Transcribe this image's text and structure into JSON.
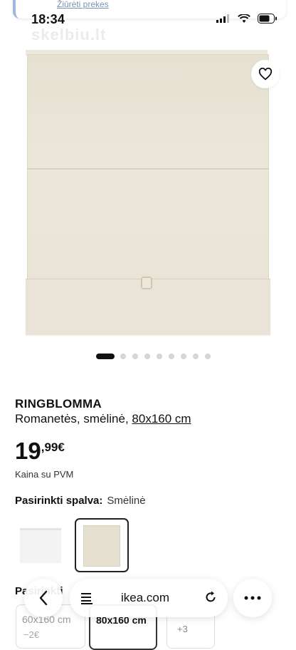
{
  "notification": {
    "link_text": "Žiūrėti prekes"
  },
  "status": {
    "time": "18:34"
  },
  "watermark": "skelbiu.lt",
  "product": {
    "brand": "RINGBLOMMA",
    "subtitle_prefix": "Romanetės, smėlinė, ",
    "size_link": "80x160 cm",
    "price_main": "19",
    "price_cents": ",99€",
    "vat_text": "Kaina su PVM"
  },
  "carousel": {
    "count": 9,
    "active_index": 0
  },
  "color": {
    "label": "Pasirinkti spalva:",
    "value": "Smėlinė"
  },
  "size": {
    "label": "Pasirinkti",
    "chips": [
      {
        "text": "60x160 cm",
        "sub": "−2€"
      },
      {
        "text": "80x160 cm",
        "sub": ""
      },
      {
        "text": "+3",
        "sub": ""
      }
    ]
  },
  "browser": {
    "url": "ikea.com"
  },
  "icons": {
    "favorite": "heart-outline-icon",
    "back": "chevron-left-icon",
    "menu": "page-menu-icon",
    "reload": "reload-icon",
    "more": "more-dots-icon"
  }
}
